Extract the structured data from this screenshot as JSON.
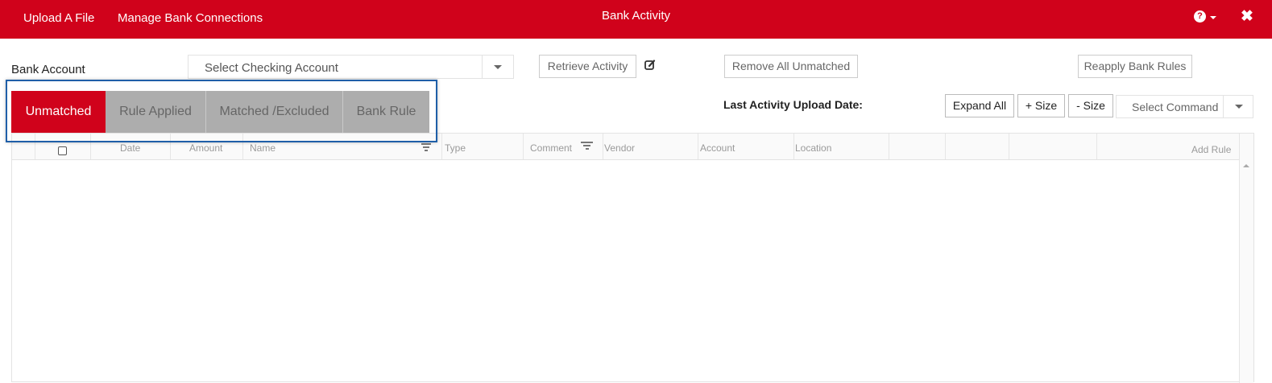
{
  "header": {
    "upload_label": "Upload A File",
    "manage_label": "Manage Bank Connections",
    "title": "Bank Activity",
    "help_glyph": "?",
    "close_glyph": "✖"
  },
  "toolbar": {
    "bank_account_label": "Bank Account",
    "account_select_value": "Select Checking Account",
    "retrieve_label": "Retrieve Activity",
    "remove_unmatched_label": "Remove All Unmatched",
    "reapply_rules_label": "Reapply Bank Rules",
    "last_upload_label": "Last Activity Upload Date:",
    "expand_all_label": "Expand All",
    "plus_size_label": "+ Size",
    "minus_size_label": "- Size",
    "command_select_value": "Select Command"
  },
  "tabs": [
    {
      "label": "Unmatched",
      "active": true
    },
    {
      "label": "Rule Applied",
      "active": false
    },
    {
      "label": "Matched /Excluded",
      "active": false
    },
    {
      "label": "Bank Rule",
      "active": false
    }
  ],
  "grid": {
    "columns": [
      "Date",
      "Amount",
      "Name",
      "Type",
      "Comment",
      "Vendor",
      "Account",
      "Location",
      "Add Rule"
    ]
  },
  "colors": {
    "brand_red": "#d0021b",
    "tab_gray": "#adadad",
    "highlight_blue": "#1f5fa8"
  }
}
